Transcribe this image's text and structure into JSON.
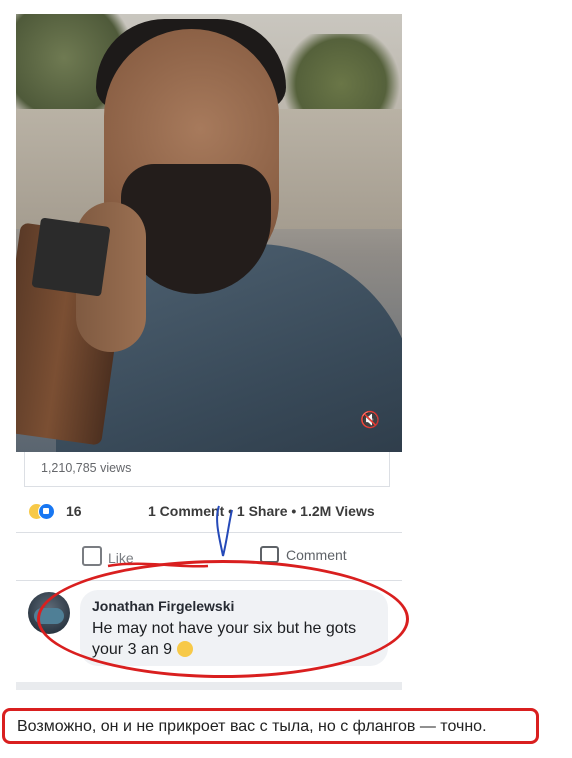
{
  "video": {
    "views_text": "1,210,785 views",
    "mute_icon": "speaker-muted-icon"
  },
  "stats": {
    "reaction_count": "16",
    "share_summary": "1 Comment • 1 Share • 1.2M Views",
    "reaction_icons": [
      "haha-icon",
      "like-icon"
    ]
  },
  "actions": {
    "like_label": "Like",
    "comment_label": "Comment"
  },
  "comment": {
    "author": "Jonathan Firgelewski",
    "text": "He may not have your six but he gots your 3 an 9",
    "emoji": "grinning-sweat-emoji"
  },
  "caption": {
    "text": "Возможно, он и не прикроет вас с тыла, но с флангов — точно."
  },
  "colors": {
    "annotation_red": "#d91f1f",
    "annotation_blue": "#2549b8",
    "facebook_blue": "#1877f2"
  }
}
